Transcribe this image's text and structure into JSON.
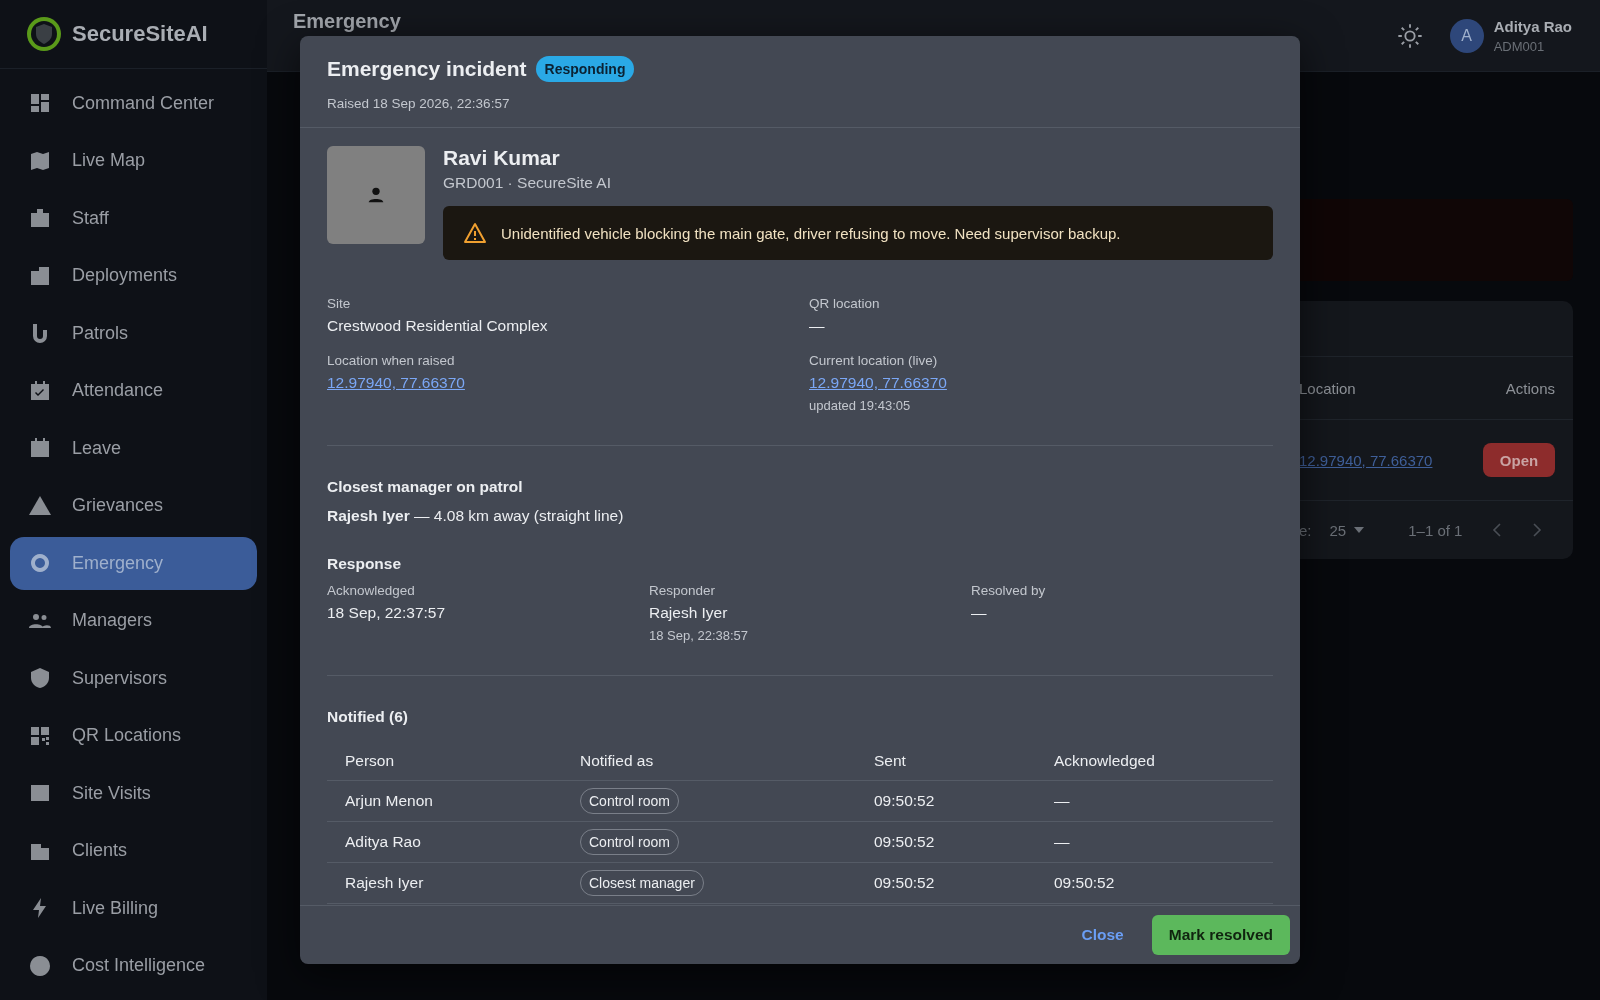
{
  "brand": {
    "name": "SecureSiteAI"
  },
  "sidebar": {
    "items": [
      {
        "label": "Command Center",
        "selected": false
      },
      {
        "label": "Live Map",
        "selected": false
      },
      {
        "label": "Staff",
        "selected": false
      },
      {
        "label": "Deployments",
        "selected": false
      },
      {
        "label": "Patrols",
        "selected": false
      },
      {
        "label": "Attendance",
        "selected": false
      },
      {
        "label": "Leave",
        "selected": false
      },
      {
        "label": "Grievances",
        "selected": false
      },
      {
        "label": "Emergency",
        "selected": true
      },
      {
        "label": "Managers",
        "selected": false
      },
      {
        "label": "Supervisors",
        "selected": false
      },
      {
        "label": "QR Locations",
        "selected": false
      },
      {
        "label": "Site Visits",
        "selected": false
      },
      {
        "label": "Clients",
        "selected": false
      },
      {
        "label": "Live Billing",
        "selected": false
      },
      {
        "label": "Cost Intelligence",
        "selected": false
      }
    ]
  },
  "header": {
    "title": "Emergency",
    "user": {
      "initial": "A",
      "name": "Aditya Rao",
      "id": "ADM001"
    }
  },
  "background_table": {
    "columns": [
      "Location",
      "Actions"
    ],
    "rows": [
      {
        "location": "12.97940, 77.66370",
        "action": "Open"
      }
    ],
    "footer": {
      "rows_label": "e:",
      "page_size": "25",
      "range": "1–1 of 1"
    }
  },
  "modal": {
    "title": "Emergency incident",
    "status": "Responding",
    "raised": "Raised 18 Sep 2026, 22:36:57",
    "guard": {
      "name": "Ravi Kumar",
      "subtitle": "GRD001 · SecureSite AI",
      "message": "Unidentified vehicle blocking the main gate, driver refusing to move. Need supervisor backup."
    },
    "fields": [
      {
        "label": "Site",
        "value": "Crestwood Residential Complex",
        "kind": "text"
      },
      {
        "label": "QR location",
        "value": "—",
        "kind": "text"
      },
      {
        "label": "Location when raised",
        "value": "12.97940, 77.66370",
        "kind": "link"
      },
      {
        "label": "Current location (live)",
        "value": "12.97940, 77.66370",
        "kind": "link",
        "note": "updated 19:43:05"
      }
    ],
    "closest": {
      "heading": "Closest manager on patrol",
      "text": "**Rajesh Iyer** — 4.08 km away (straight line)"
    },
    "response": {
      "heading": "Response",
      "items": [
        {
          "label": "Acknowledged",
          "value": "18 Sep, 22:37:57"
        },
        {
          "label": "Responder",
          "value": "Rajesh Iyer",
          "note": "18 Sep, 22:38:57"
        },
        {
          "label": "Resolved by",
          "value": "—"
        }
      ]
    },
    "notified": {
      "heading": "Notified (6)",
      "columns": [
        "Person",
        "Notified as",
        "Sent",
        "Acknowledged"
      ],
      "rows": [
        {
          "person": "Arjun Menon",
          "role": "Control room",
          "sent": "09:50:52",
          "acknowledged": "—"
        },
        {
          "person": "Aditya Rao",
          "role": "Control room",
          "sent": "09:50:52",
          "acknowledged": "—"
        },
        {
          "person": "Rajesh Iyer",
          "role": "Closest manager",
          "sent": "09:50:52",
          "acknowledged": "09:50:52"
        }
      ]
    },
    "buttons": {
      "close": "Close",
      "resolve": "Mark resolved"
    }
  }
}
